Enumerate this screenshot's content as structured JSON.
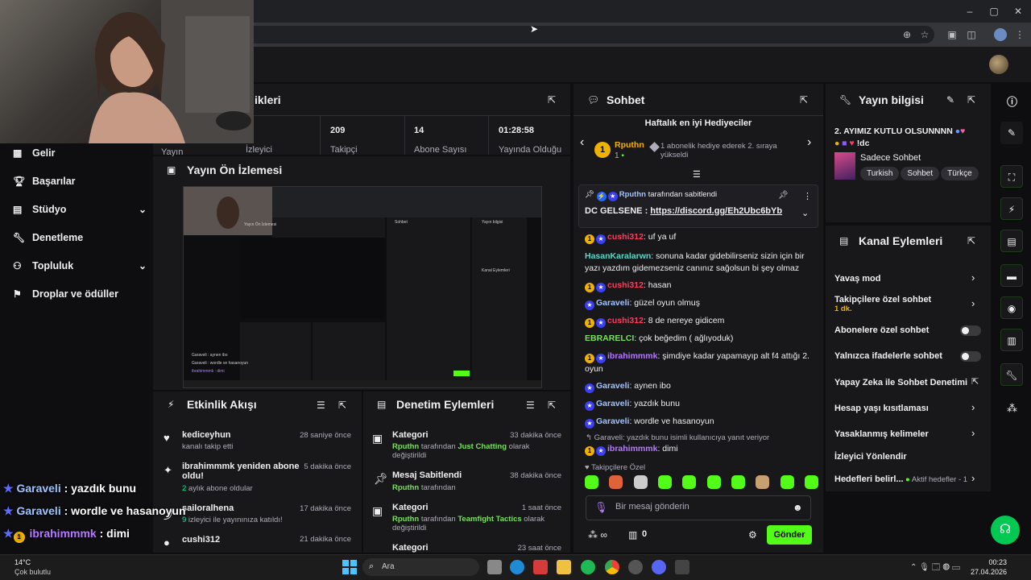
{
  "stats": [
    {
      "value": "",
      "label": "Yayın"
    },
    {
      "value": "",
      "label": "İzleyici"
    },
    {
      "value": "209",
      "label": "Takipçi"
    },
    {
      "value": "14",
      "label": "Abone Sayısı"
    },
    {
      "value": "01:28:58",
      "label": "Yayında Olduğu"
    }
  ],
  "stats_title_fragment": "ikleri",
  "nav": [
    {
      "label": "Gelir",
      "icon": "revenue-icon"
    },
    {
      "label": "Başarılar",
      "icon": "trophy-icon"
    },
    {
      "label": "Stüdyo",
      "icon": "studio-icon",
      "chevron": true
    },
    {
      "label": "Denetleme",
      "icon": "wrench-icon"
    },
    {
      "label": "Topluluk",
      "icon": "community-icon",
      "chevron": true
    },
    {
      "label": "Droplar ve ödüller",
      "icon": "drops-icon"
    }
  ],
  "preview": {
    "title": "Yayın Ön İzlemesi"
  },
  "activity": {
    "title": "Etkinlik Akışı",
    "items": [
      {
        "name": "kediceyhun",
        "sub": "kanalı takip etti",
        "sub_prefix": "",
        "time": "28 saniye önce",
        "icon": "heart-icon"
      },
      {
        "name": "ibrahimmmk yeniden abone oldu!",
        "sub_prefix": "2",
        "sub": " aylık abone oldular",
        "time": "5 dakika önce",
        "icon": "star-icon"
      },
      {
        "name": "sailoralhena",
        "sub_prefix": "9",
        "sub": " izleyici ile yayınınıza katıldı!",
        "time": "17 dakika önce",
        "icon": "raid-icon"
      },
      {
        "name": "cushi312",
        "sub_prefix": "",
        "sub": "",
        "time": "21 dakika önce",
        "icon": "user-icon"
      }
    ]
  },
  "modlog": {
    "title": "Denetim Eylemleri",
    "items": [
      {
        "name": "Kategori",
        "time": "33 dakika önce",
        "user": "Rputhn",
        "mid": " tarafından ",
        "target": "Just Chatting",
        "end": " olarak değiştirildi",
        "icon": "category-icon"
      },
      {
        "name": "Mesaj Sabitlendi",
        "time": "38 dakika önce",
        "user": "Rputhn",
        "mid": " tarafından",
        "target": "",
        "end": "",
        "icon": "pin-icon"
      },
      {
        "name": "Kategori",
        "time": "1 saat önce",
        "user": "Rputhn",
        "mid": " tarafından ",
        "target": "Teamfight Tactics",
        "end": " olarak değiştirildi",
        "icon": "category-icon"
      },
      {
        "name": "Kategori",
        "time": "23 saat önce",
        "user": "",
        "mid": "",
        "target": "",
        "end": "",
        "icon": "category-icon"
      }
    ]
  },
  "chat": {
    "title": "Sohbet",
    "gifters_title": "Haftalık en iyi Hediyeciler",
    "gifter_name": "Rputhn",
    "gifter_count": "1",
    "gifter_text": "1 abonelik hediye ederek 2. sıraya yükseldi",
    "pinned_by": "Rputhn",
    "pinned_suffix": " tarafından sabitlendi",
    "pinned_msg_prefix": "DC GELSENE : ",
    "pinned_link": "https://discord.gg/Eh2Ubc6bYb",
    "partial_line": "EBRARELCI: ...",
    "messages": [
      {
        "user": "cushi312",
        "color": "#ff3b5c",
        "badges": [
          "gold",
          "star"
        ],
        "text": "uf ya uf"
      },
      {
        "user": "HasanKaralarwn",
        "color": "#5cd6c6",
        "badges": [],
        "text": "sonuna kadar gidebilirseniz sizin için bir yazı yazdım gidemezseniz canınız sağolsun bi şey olmaz"
      },
      {
        "user": "cushi312",
        "color": "#ff3b5c",
        "badges": [
          "gold",
          "star"
        ],
        "text": "hasan"
      },
      {
        "user": "Garaveli",
        "color": "#a0c4ff",
        "badges": [
          "star"
        ],
        "text": "güzel oyun olmuş"
      },
      {
        "user": "cushi312",
        "color": "#ff3b5c",
        "badges": [
          "gold",
          "star"
        ],
        "text": "8 de nereye gidicem"
      },
      {
        "user": "EBRARELCI",
        "color": "#7ae05c",
        "badges": [],
        "text": "çok beğedim ( ağlıyoduk)"
      },
      {
        "user": "ibrahimmmk",
        "color": "#b57aff",
        "badges": [
          "gold",
          "star"
        ],
        "text": "şimdiye kadar yapamayıp alt f4 attığı 2. oyun"
      },
      {
        "user": "Garaveli",
        "color": "#a0c4ff",
        "badges": [
          "star"
        ],
        "text": "aynen ibo"
      },
      {
        "user": "Garaveli",
        "color": "#a0c4ff",
        "badges": [
          "star"
        ],
        "text": "yazdık bunu"
      },
      {
        "user": "Garaveli",
        "color": "#a0c4ff",
        "badges": [
          "star"
        ],
        "text": "wordle ve hasanoyun"
      }
    ],
    "reply_context": "Garaveli: yazdık bunu isimli kullanıcıya yanıt veriyor",
    "reply_message": {
      "user": "ibrahimmmk",
      "color": "#b57aff",
      "text": "dimi"
    },
    "followers_only": "Takipçilere Özel",
    "input_placeholder": "Bir mesaj gönderin",
    "points": "0",
    "send_label": "Gönder"
  },
  "info": {
    "title": "Yayın bilgisi",
    "stream_title": "2. AYIMIZ KUTLU OLSUNNNN",
    "stream_title_suffix": "!dc",
    "category": "Sadece Sohbet",
    "tags": [
      "Turkish",
      "Sohbet",
      "Türkçe"
    ]
  },
  "actions": {
    "title": "Kanal Eylemleri",
    "items": [
      {
        "label": "Yavaş mod",
        "control": "chevron"
      },
      {
        "label": "Takipçilere özel sohbet",
        "sub": "1 dk.",
        "control": "chevron"
      },
      {
        "label": "Abonelere özel sohbet",
        "control": "toggle"
      },
      {
        "label": "Yalnızca ifadelerle sohbet",
        "control": "toggle"
      },
      {
        "label": "Yapay Zeka ile Sohbet Denetimi",
        "control": "external"
      },
      {
        "label": "Hesap yaşı kısıtlaması",
        "control": "chevron"
      },
      {
        "label": "Yasaklanmış kelimeler",
        "control": "chevron"
      },
      {
        "label": "İzleyici Yönlendir",
        "control": "none"
      },
      {
        "label": "Hedefleri belirl...",
        "sub": "Aktif hedefler - 1",
        "control": "chevron"
      }
    ]
  },
  "overlay_chat": [
    {
      "user": "Garaveli",
      "text": " : yazdık bunu"
    },
    {
      "user": "Garaveli",
      "text": " : wordle ve hasanoyun"
    },
    {
      "user": "ibrahimmmk",
      "text": " : dimi"
    }
  ],
  "taskbar": {
    "weather_temp": "14°C",
    "weather_desc": "Çok bulutlu",
    "search_placeholder": "Ara",
    "time": "00:23",
    "date": "27.04.2026"
  },
  "colors": {
    "accent": "#53fc18",
    "bg": "#0e0e10",
    "panel": "#18181b",
    "green_text": "#00f593"
  }
}
